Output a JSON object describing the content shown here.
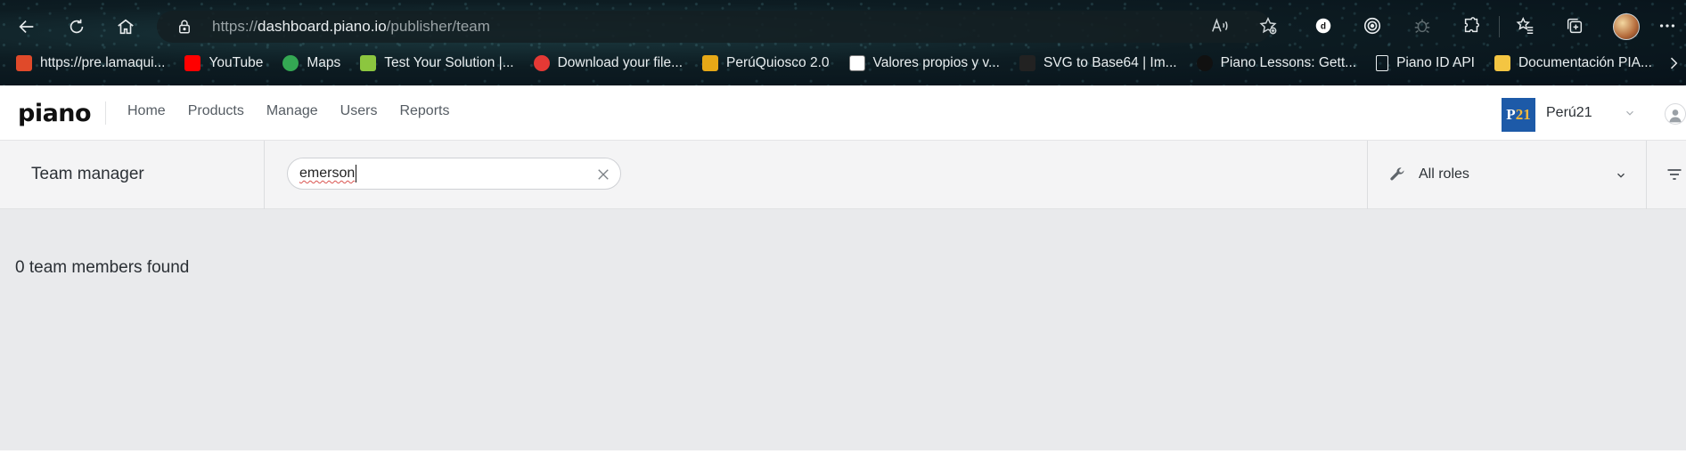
{
  "browser": {
    "url_scheme": "https://",
    "url_domain": "dashboard.piano.io",
    "url_path": "/publisher/team",
    "bookmarks": [
      {
        "label": "https://pre.lamaqui...",
        "icon": "lamaquina-icon",
        "color": "#e04a2a"
      },
      {
        "label": "YouTube",
        "icon": "youtube-icon",
        "color": "#ff0000"
      },
      {
        "label": "Maps",
        "icon": "maps-icon",
        "color": "#34a853"
      },
      {
        "label": "Test Your Solution |...",
        "icon": "u-icon",
        "color": "#8cc63f"
      },
      {
        "label": "Download your file...",
        "icon": "download-icon",
        "color": "#e53935"
      },
      {
        "label": "PerúQuiosco 2.0",
        "icon": "quiosco-icon",
        "color": "#e6a817"
      },
      {
        "label": "Valores propios y v...",
        "icon": "matrix-icon",
        "color": "#ffffff"
      },
      {
        "label": "SVG to Base64 | Im...",
        "icon": "svg-tool-icon",
        "color": "#222222"
      },
      {
        "label": "Piano Lessons: Gett...",
        "icon": "piano-lessons-icon",
        "color": "#111111"
      },
      {
        "label": "Piano ID API",
        "icon": "page-icon",
        "color": "#e9eef0"
      },
      {
        "label": "Documentación PIA...",
        "icon": "folder-icon",
        "color": "#f4c542"
      }
    ]
  },
  "app": {
    "logo": "piano",
    "nav": [
      "Home",
      "Products",
      "Manage",
      "Users",
      "Reports"
    ],
    "publisher": {
      "badge_letter": "P",
      "badge_number": "21",
      "name": "Perú21"
    }
  },
  "toolbar": {
    "title": "Team manager",
    "search_value": "emerson",
    "roles_label": "All roles"
  },
  "content": {
    "results_text": "0 team members found"
  },
  "colors": {
    "page_bg": "#e9eaec",
    "toolbar_bg": "#f4f4f5",
    "badge_bg": "#1d5aa8",
    "badge_fg": "#f2b93b"
  }
}
